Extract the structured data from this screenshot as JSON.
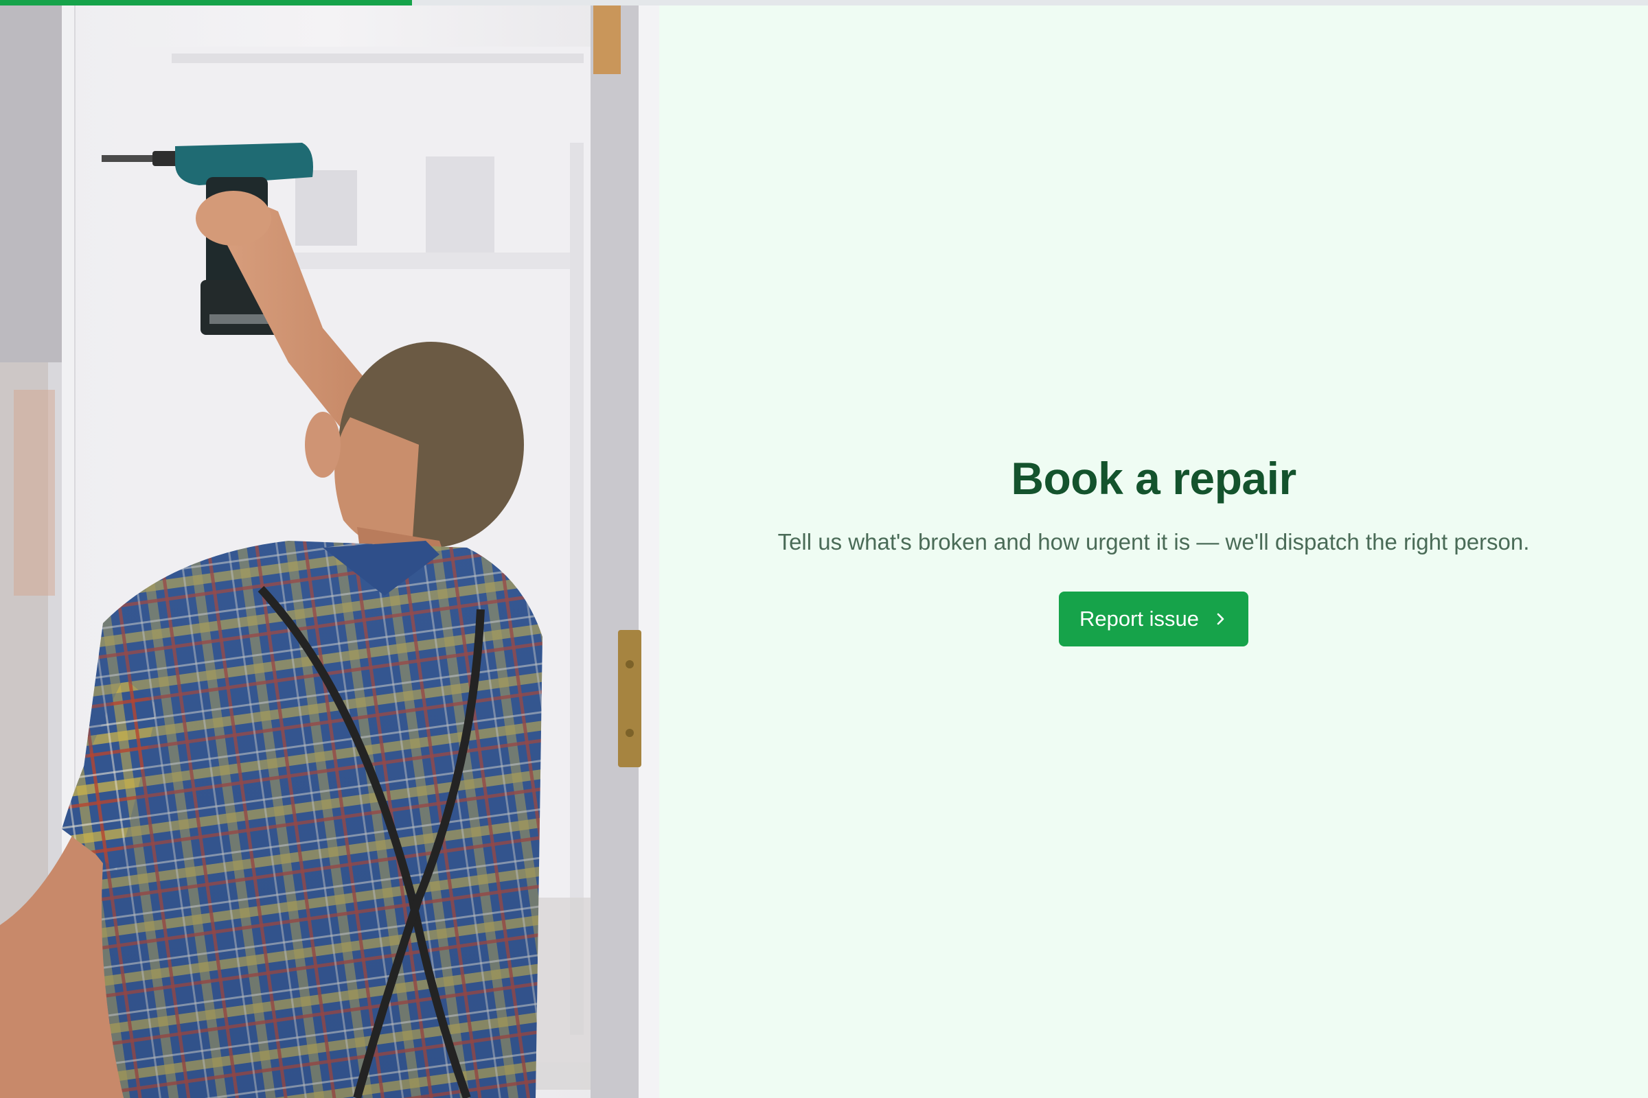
{
  "progress": {
    "fraction": 0.25,
    "color": "#16a34a"
  },
  "hero_image": {
    "subject": "handyman-drilling-window-frame"
  },
  "main": {
    "title": "Book a repair",
    "subtitle": "Tell us what's broken and how urgent it is — we'll dispatch the right person.",
    "cta_label": "Report issue",
    "cta_icon": "chevron-right-icon"
  },
  "colors": {
    "accent": "#16a34a",
    "title": "#14532d",
    "subtitle": "#4a6b57",
    "background": "#effcf3"
  }
}
